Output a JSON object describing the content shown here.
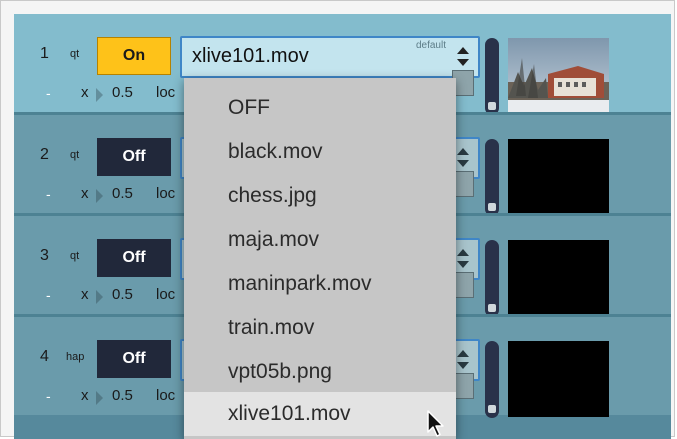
{
  "rows": [
    {
      "index": "1",
      "type": "qt",
      "state": "On",
      "file": "xlive101.mov",
      "default_label": "default",
      "amount_prefix": "-",
      "x_label": "x",
      "value": "0.5",
      "loc_label": "loc"
    },
    {
      "index": "2",
      "type": "qt",
      "state": "Off",
      "amount_prefix": "-",
      "x_label": "x",
      "value": "0.5",
      "loc_label": "loc"
    },
    {
      "index": "3",
      "type": "qt",
      "state": "Off",
      "amount_prefix": "-",
      "x_label": "x",
      "value": "0.5",
      "loc_label": "loc"
    },
    {
      "index": "4",
      "type": "hap",
      "state": "Off",
      "amount_prefix": "-",
      "x_label": "x",
      "value": "0.5",
      "loc_label": "loc"
    }
  ],
  "dropdown": {
    "items": [
      "OFF",
      "black.mov",
      "chess.jpg",
      "maja.mov",
      "maninpark.mov",
      "train.mov",
      "vpt05b.png",
      "xlive101.mov"
    ],
    "selected": "xlive101.mov"
  },
  "colors": {
    "on_button": "#fec219",
    "off_button": "#21283a",
    "row_active": "#83bccd",
    "row_inactive": "#6a9bab",
    "menu_bg": "#c6c6c6"
  },
  "icons": [
    "stepper-arrows-icon",
    "mouse-pointer-icon"
  ]
}
